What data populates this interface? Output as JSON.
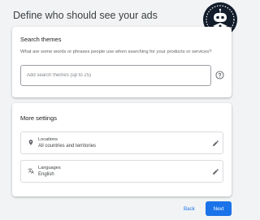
{
  "page": {
    "title": "Define who should see your ads"
  },
  "search_themes": {
    "heading": "Search themes",
    "description": "What are some words or phrases people use when searching for your products or services?",
    "input_value": "",
    "input_placeholder": "Add search themes (up to 25)",
    "help_icon": "help-circle-icon"
  },
  "more_settings": {
    "heading": "More settings",
    "rows": [
      {
        "label": "Locations",
        "value": "All countries and territories",
        "icon": "location-pin-icon",
        "action_icon": "edit-pencil-icon"
      },
      {
        "label": "Languages",
        "value": "English",
        "icon": "translate-icon",
        "action_icon": "edit-pencil-icon"
      }
    ]
  },
  "footer": {
    "back_label": "Back",
    "next_label": "Next"
  },
  "colors": {
    "accent": "#1a73e8",
    "background": "#f1f3f4",
    "card": "#ffffff",
    "badge_background": "#131c2b"
  }
}
